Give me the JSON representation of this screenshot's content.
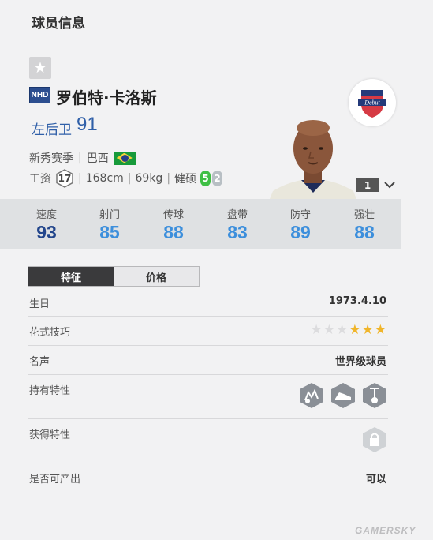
{
  "page_title": "球员信息",
  "player": {
    "season_badge": "NHD",
    "name": "罗伯特·卡洛斯",
    "position": "左后卫",
    "position_ovr": "91",
    "meta": [
      "新秀赛季",
      "巴西"
    ],
    "wage_label": "工资",
    "wage": "17",
    "height": "168cm",
    "weight": "69kg",
    "physique": "健硕",
    "weak_foot_left": "5",
    "weak_foot_right": "2",
    "level": "1",
    "club_logo_text": "Debut"
  },
  "stats": [
    {
      "label": "速度",
      "value": "93"
    },
    {
      "label": "射门",
      "value": "85"
    },
    {
      "label": "传球",
      "value": "88"
    },
    {
      "label": "盘带",
      "value": "83"
    },
    {
      "label": "防守",
      "value": "89"
    },
    {
      "label": "强壮",
      "value": "88"
    }
  ],
  "tabs": {
    "features": "特征",
    "price": "价格"
  },
  "info": {
    "birthday_label": "生日",
    "birthday": "1973.4.10",
    "skill_label": "花式技巧",
    "skill_stars": 3,
    "skill_max": 6,
    "reputation_label": "名声",
    "reputation": "世界级球员",
    "owned_traits_label": "持有特性",
    "owned_traits": [
      "goalkeeper-trait-icon",
      "boot-trait-icon",
      "tie-trait-icon"
    ],
    "acquired_traits_label": "获得特性",
    "producible_label": "是否可产出",
    "producible": "可以"
  },
  "watermark": "GAMERSKY",
  "colors": {
    "stat_dark": "#23468c",
    "stat_light": "#3d8fdc",
    "position": "#2f5fa8"
  }
}
